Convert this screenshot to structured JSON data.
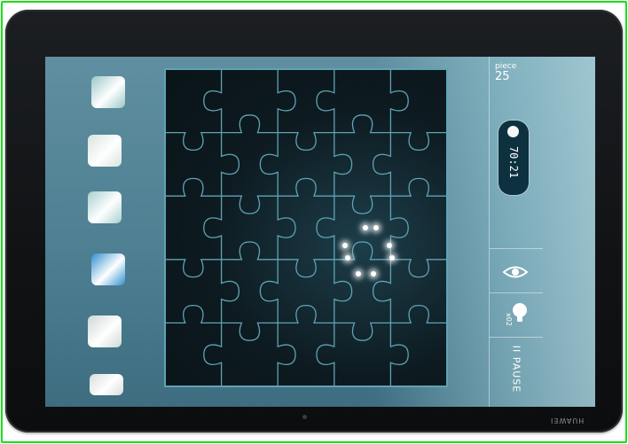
{
  "device": {
    "brand": "HUAWEI"
  },
  "game": {
    "piece_label": "piece",
    "piece_count": "25",
    "timer": "70:21",
    "hint_count": "x02",
    "pause_label": "II PAUSE"
  },
  "board": {
    "rows": 5,
    "cols": 5
  },
  "tray": {
    "pieces": [
      {
        "name": "tray-piece-1",
        "color": "#9bc7c8"
      },
      {
        "name": "tray-piece-2",
        "color": "#d9e3dd"
      },
      {
        "name": "tray-piece-3",
        "color": "#a7d0cf"
      },
      {
        "name": "tray-piece-4",
        "color": "#2e8fd0"
      },
      {
        "name": "tray-piece-5",
        "color": "#cdd8d5"
      },
      {
        "name": "tray-piece-6",
        "color": "#d7dedb"
      }
    ]
  },
  "colors": {
    "board_line": "#5fa3b5",
    "screen_bg": "#4e7f92",
    "timer_bg": "#0e3140"
  },
  "icons": {
    "eye": "eye-icon",
    "bulb": "lightbulb-icon"
  }
}
